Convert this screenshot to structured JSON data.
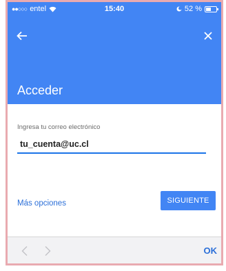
{
  "status_bar": {
    "carrier": "entel",
    "time": "15:40",
    "battery_text": "52 %",
    "battery_level_percent": 52
  },
  "header": {
    "title": "Acceder",
    "back_icon": "arrow-left-icon",
    "close_icon": "close-icon"
  },
  "form": {
    "email_label": "Ingresa tu correo electrónico",
    "email_value": "tu_cuenta@uc.cl",
    "more_options": "Más opciones",
    "next_button": "SIGUIENTE"
  },
  "toolbar": {
    "ok_label": "OK"
  },
  "colors": {
    "primary": "#4285f4",
    "link": "#2b6fd8",
    "frame": "#e9aab0"
  }
}
